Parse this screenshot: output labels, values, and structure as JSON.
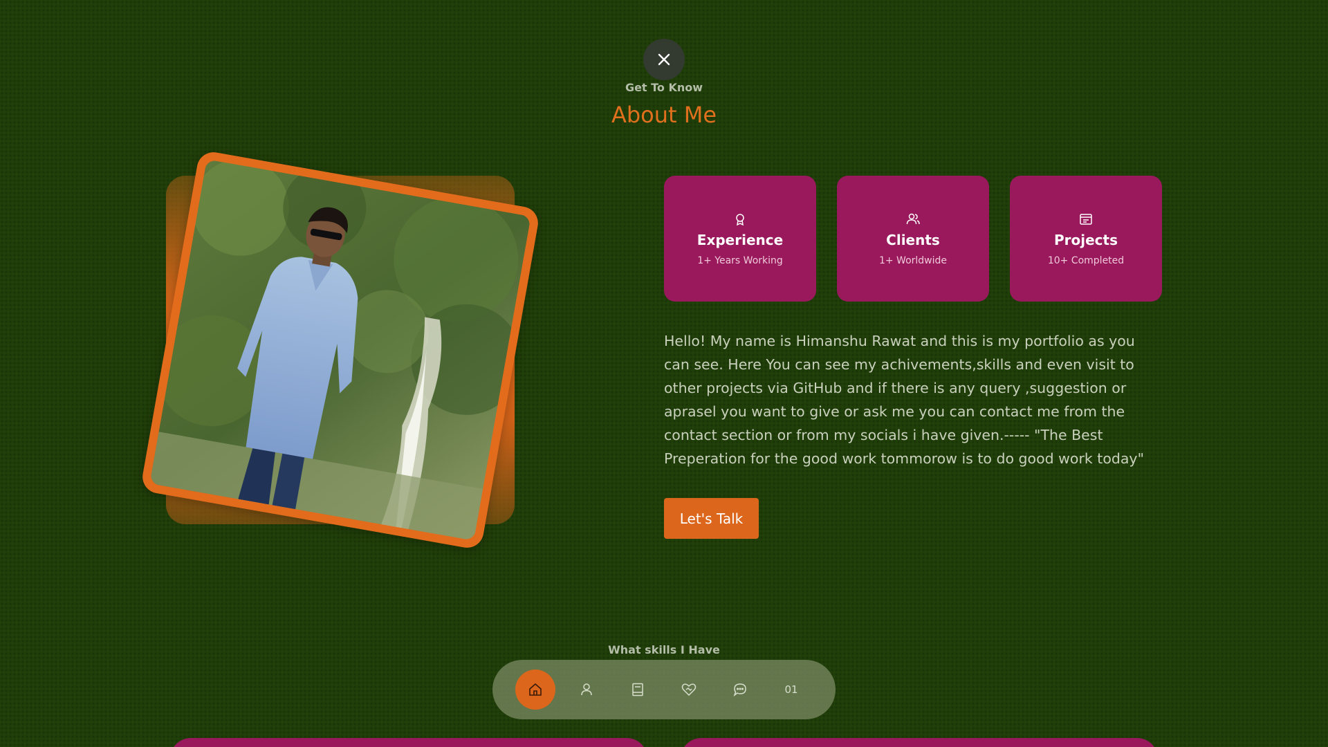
{
  "header": {
    "eyebrow": "Get To Know",
    "title": "About Me"
  },
  "close_icon": "close-icon",
  "photo": {
    "alt": "Portrait of Himanshu Rawat standing in front of a waterfall"
  },
  "cards": [
    {
      "icon": "award-icon",
      "title": "Experience",
      "subtitle": "1+ Years Working"
    },
    {
      "icon": "users-icon",
      "title": "Clients",
      "subtitle": "1+ Worldwide"
    },
    {
      "icon": "projects-icon",
      "title": "Projects",
      "subtitle": "10+ Completed"
    }
  ],
  "bio": "Hello! My name is Himanshu Rawat and this is my portfolio as you can see. Here You can see my achivements,skills and even visit to other projects via GitHub and if there is any query ,suggestion or aprasel you want to give or ask me you can contact me from the contact section or from my socials i have given.----- \"The Best Preperation for the good work tommorow is to do good work today\"",
  "cta": {
    "label": "Let's Talk"
  },
  "skills": {
    "eyebrow": "What skills I Have"
  },
  "nav": {
    "items": [
      {
        "icon": "home-icon",
        "active": true
      },
      {
        "icon": "user-icon"
      },
      {
        "icon": "book-icon"
      },
      {
        "icon": "service-icon"
      },
      {
        "icon": "chat-icon"
      },
      {
        "label": "01"
      }
    ]
  },
  "colors": {
    "background": "#1f3d08",
    "accent": "#dc661b",
    "card": "#99195c",
    "nav": "#708058"
  }
}
